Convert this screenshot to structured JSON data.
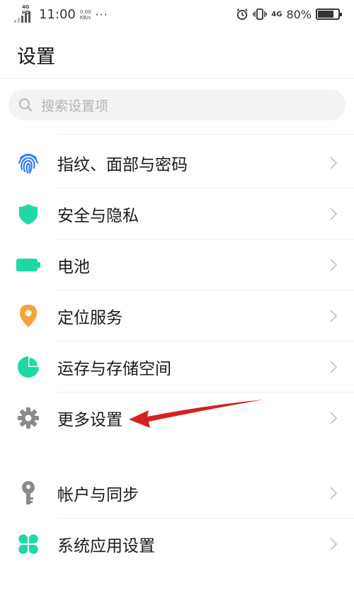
{
  "status_bar": {
    "network_tag": "4G HD",
    "time": "11:00",
    "speed_value": "0.00",
    "speed_unit": "KB/s",
    "more": "···",
    "network2": "4G",
    "battery_percent": "80%",
    "battery_level": 0.8
  },
  "page": {
    "title": "设置"
  },
  "search": {
    "placeholder": "搜索设置项"
  },
  "items": [
    {
      "label": "指纹、面部与密码",
      "icon": "fingerprint-icon",
      "color": "#3a7bf7"
    },
    {
      "label": "安全与隐私",
      "icon": "shield-icon",
      "color": "#1fd8a4"
    },
    {
      "label": "电池",
      "icon": "battery-icon",
      "color": "#1fd8a4"
    },
    {
      "label": "定位服务",
      "icon": "location-pin-icon",
      "color": "#f6a33b"
    },
    {
      "label": "运存与存储空间",
      "icon": "pie-chart-icon",
      "color": "#1fd8a4"
    },
    {
      "label": "更多设置",
      "icon": "gear-icon",
      "color": "#8a8a8a"
    },
    {
      "label": "帐户与同步",
      "icon": "key-icon",
      "color": "#8a8a8a"
    },
    {
      "label": "系统应用设置",
      "icon": "apps-grid-icon",
      "color": "#1fd8a4"
    }
  ],
  "annotation": {
    "arrow_color": "#d52222"
  }
}
